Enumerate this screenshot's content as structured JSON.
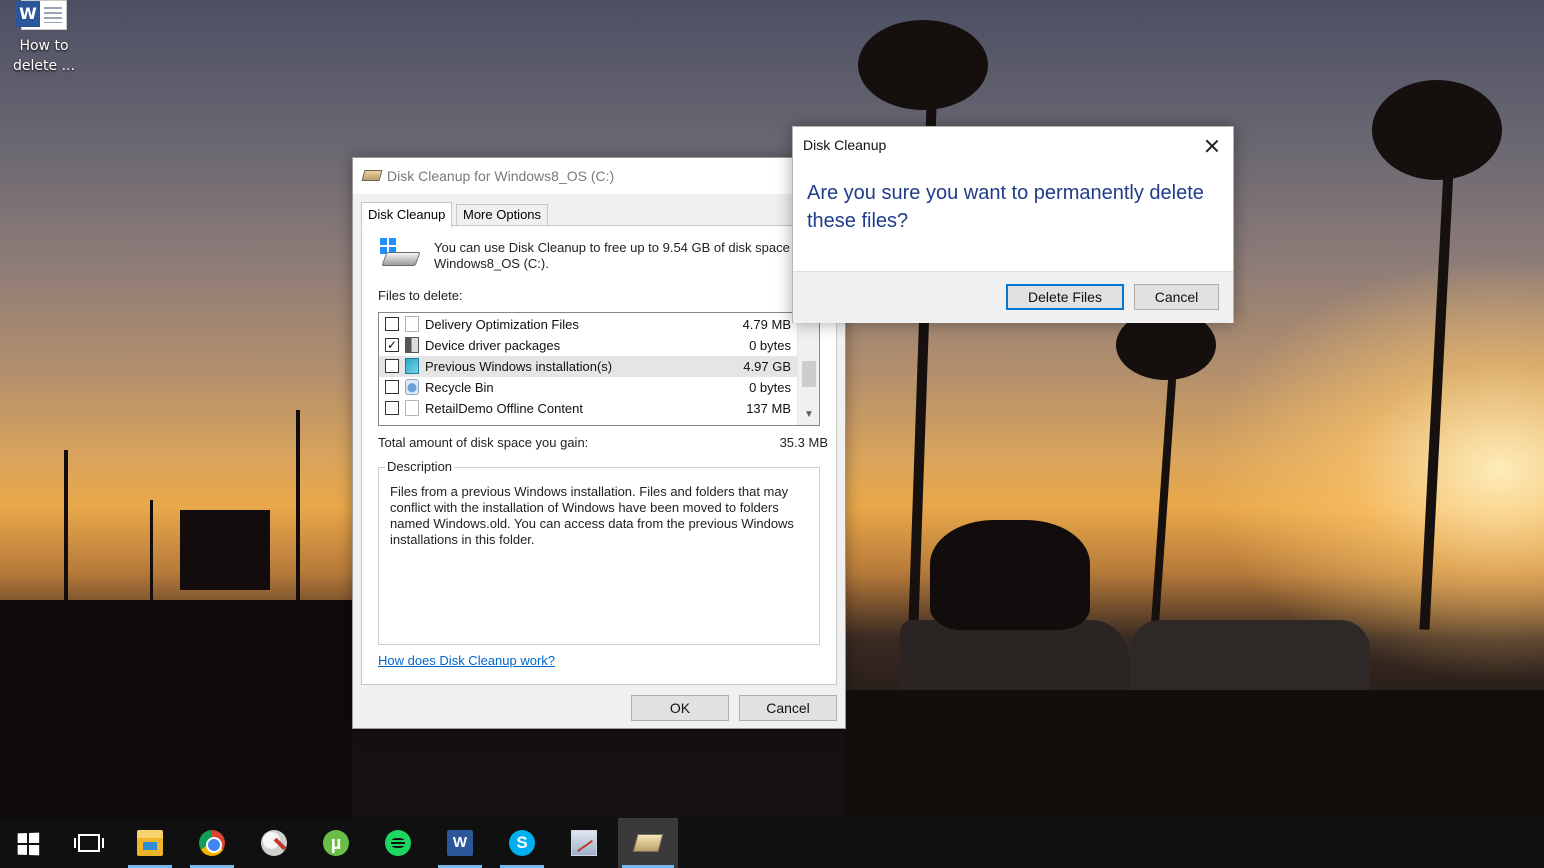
{
  "desktop": {
    "icon_label": "How to delete ...",
    "icon_name": "word-document-icon"
  },
  "main_window": {
    "title": "Disk Cleanup for Windows8_OS (C:)",
    "tabs": [
      {
        "label": "Disk Cleanup",
        "active": true
      },
      {
        "label": "More Options",
        "active": false
      }
    ],
    "intro": "You can use Disk Cleanup to free up to 9.54 GB of disk space on Windows8_OS (C:).",
    "files_label": "Files to delete:",
    "files": [
      {
        "name": "Delivery Optimization Files",
        "size": "4.79 MB",
        "checked": false,
        "icon": "file-icon"
      },
      {
        "name": "Device driver packages",
        "size": "0 bytes",
        "checked": true,
        "icon": "driver-icon"
      },
      {
        "name": "Previous Windows installation(s)",
        "size": "4.97 GB",
        "checked": false,
        "icon": "windows-install-icon",
        "selected": true
      },
      {
        "name": "Recycle Bin",
        "size": "0 bytes",
        "checked": false,
        "icon": "recycle-bin-icon"
      },
      {
        "name": "RetailDemo Offline Content",
        "size": "137 MB",
        "checked": false,
        "icon": "file-icon"
      }
    ],
    "total_label": "Total amount of disk space you gain:",
    "total_value": "35.3 MB",
    "description_legend": "Description",
    "description_text": "Files from a previous Windows installation.  Files and folders that may conflict with the installation of Windows have been moved to folders named Windows.old.  You can access data from the previous Windows installations in this folder.",
    "help_link": "How does Disk Cleanup work?",
    "ok_label": "OK",
    "cancel_label": "Cancel"
  },
  "confirm_dialog": {
    "title": "Disk Cleanup",
    "question": "Are you sure you want to permanently delete these files?",
    "delete_label": "Delete Files",
    "cancel_label": "Cancel"
  },
  "taskbar": {
    "items": [
      {
        "name": "start-button",
        "icon": "windows-logo-icon"
      },
      {
        "name": "task-view-button",
        "icon": "task-view-icon"
      },
      {
        "name": "file-explorer",
        "icon": "folder-icon",
        "running": true
      },
      {
        "name": "chrome",
        "icon": "chrome-icon",
        "running": true
      },
      {
        "name": "paint",
        "icon": "paint-icon"
      },
      {
        "name": "utorrent",
        "icon": "utorrent-icon"
      },
      {
        "name": "spotify",
        "icon": "spotify-icon"
      },
      {
        "name": "word",
        "icon": "word-icon",
        "running": true
      },
      {
        "name": "skype",
        "icon": "skype-icon",
        "running": true
      },
      {
        "name": "resource-monitor",
        "icon": "resource-monitor-icon"
      },
      {
        "name": "disk-cleanup",
        "icon": "disk-cleanup-icon",
        "running": true,
        "active": true
      }
    ]
  },
  "colors": {
    "accent": "#0078d7",
    "dialog_text": "#1f3b8a",
    "link": "#0066cc",
    "taskbar": "#101010"
  }
}
